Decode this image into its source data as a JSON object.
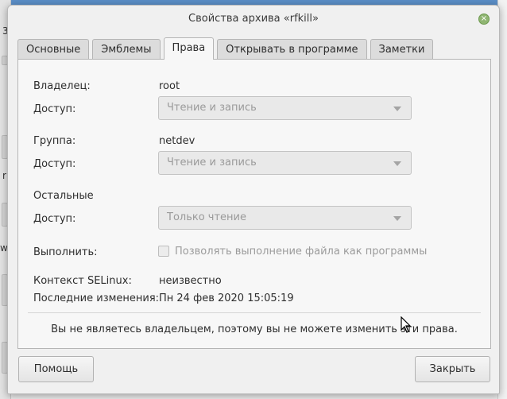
{
  "dialog": {
    "title": "Свойства архива «rfkill»"
  },
  "tabs": [
    {
      "label": "Основные"
    },
    {
      "label": "Эмблемы"
    },
    {
      "label": "Права"
    },
    {
      "label": "Открывать в программе"
    },
    {
      "label": "Заметки"
    }
  ],
  "permissions": {
    "owner_label": "Владелец:",
    "owner_value": "root",
    "owner_access_label": "Доступ:",
    "owner_access_value": "Чтение и запись",
    "group_label": "Группа:",
    "group_value": "netdev",
    "group_access_label": "Доступ:",
    "group_access_value": "Чтение и запись",
    "others_label": "Остальные",
    "others_access_label": "Доступ:",
    "others_access_value": "Только чтение",
    "execute_label": "Выполнить:",
    "execute_checkbox_label": "Позволять выполнение файла как программы",
    "selinux_label": "Контекст SELinux:",
    "selinux_value": "неизвестно",
    "modified_label": "Последние изменения:",
    "modified_value": "Пн 24 фев 2020 15:05:19",
    "notice": "Вы не являетесь владельцем, поэтому вы не можете изменить эти права."
  },
  "buttons": {
    "help": "Помощь",
    "close": "Закрыть"
  },
  "background": {
    "left_glyphs": [
      "3",
      "r",
      "w"
    ]
  }
}
